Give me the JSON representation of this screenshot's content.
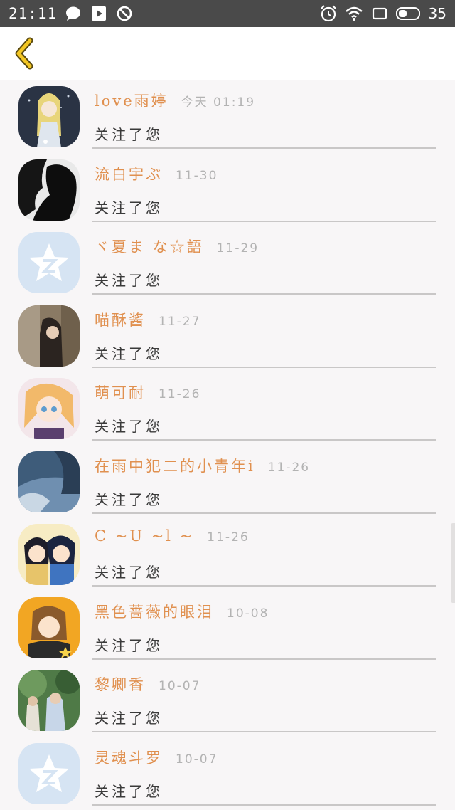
{
  "status_bar": {
    "time": "21:11",
    "battery": "35",
    "icons": [
      "chat-bubble-icon",
      "play-store-icon",
      "block-icon",
      "alarm-icon",
      "wifi-icon",
      "screen-icon",
      "battery-icon"
    ]
  },
  "nav": {
    "back_icon": "chevron-left-icon"
  },
  "colors": {
    "name": "#e0904f",
    "time": "#b3b3b3",
    "back": "#f3c623",
    "qq_avatar_bg": "#d6e4f3"
  },
  "items": [
    {
      "name": "love雨婷",
      "time": "今天 01:19",
      "action": "关注了您",
      "avatar": "anime-girl-avatar"
    },
    {
      "name": "流白宇ぶ",
      "time": "11-30",
      "action": "关注了您",
      "avatar": "dark-silhouette-avatar"
    },
    {
      "name": "ヾ夏ま な☆語",
      "time": "11-29",
      "action": "关注了您",
      "avatar": "qq-default-avatar"
    },
    {
      "name": "喵酥酱",
      "time": "11-27",
      "action": "关注了您",
      "avatar": "photo-girl-avatar"
    },
    {
      "name": "萌可耐",
      "time": "11-26",
      "action": "关注了您",
      "avatar": "anime-blonde-avatar"
    },
    {
      "name": "在雨中犯二的小青年i",
      "time": "11-26",
      "action": "关注了您",
      "avatar": "blue-photo-avatar"
    },
    {
      "name": "C ~U ~l ~",
      "time": "11-26",
      "action": "关注了您",
      "avatar": "conan-avatar"
    },
    {
      "name": "黑色蔷薇的眼泪",
      "time": "10-08",
      "action": "关注了您",
      "avatar": "anime-orange-avatar"
    },
    {
      "name": "黎卿香",
      "time": "10-07",
      "action": "关注了您",
      "avatar": "green-photo-avatar"
    },
    {
      "name": "灵魂斗罗",
      "time": "10-07",
      "action": "关注了您",
      "avatar": "qq-default-avatar"
    }
  ]
}
